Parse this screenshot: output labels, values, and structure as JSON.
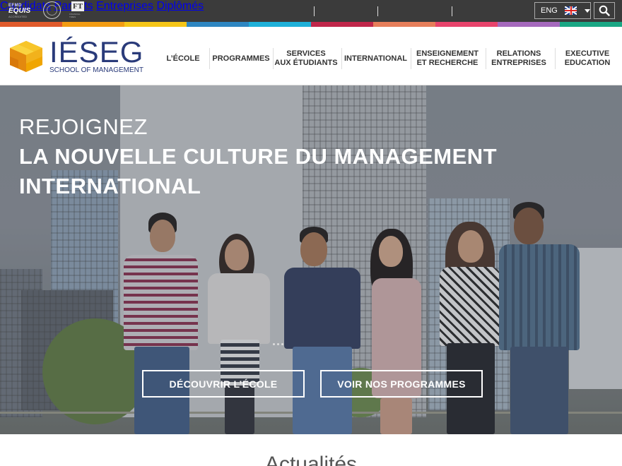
{
  "topbar": {
    "accreditations": {
      "equis_top": "EFMD",
      "equis_name": "EQUIS",
      "equis_sub": "ACCREDITED",
      "ft_name": "FT",
      "ft_sub": "FINANCIAL TIMES"
    },
    "links": [
      "Candidats",
      "Parents",
      "Entreprises",
      "Diplômés"
    ],
    "language": {
      "code": "ENG",
      "flag": "uk-flag-icon"
    },
    "search_icon": "search-icon"
  },
  "color_strip": [
    "#e05a2b",
    "#f39c12",
    "#f5c518",
    "#2e86c1",
    "#1eb0d8",
    "#c0264a",
    "#e67e5a",
    "#e8446c",
    "#a569bd",
    "#1aa784"
  ],
  "header": {
    "logo": {
      "word": "IÉSEG",
      "sub": "SCHOOL OF MANAGEMENT"
    },
    "nav": [
      {
        "line1": "L’ÉCOLE",
        "line2": ""
      },
      {
        "line1": "PROGRAMMES",
        "line2": ""
      },
      {
        "line1": "SERVICES",
        "line2": "AUX ÉTUDIANTS"
      },
      {
        "line1": "INTERNATIONAL",
        "line2": ""
      },
      {
        "line1": "ENSEIGNEMENT",
        "line2": "ET RECHERCHE"
      },
      {
        "line1": "RELATIONS",
        "line2": "ENTREPRISES"
      },
      {
        "line1": "EXECUTIVE",
        "line2": "EDUCATION"
      }
    ]
  },
  "hero": {
    "title_line1": "REJOIGNEZ",
    "title_line2": "LA NOUVELLE CULTURE DU MANAGEMENT INTERNATIONAL",
    "buttons": [
      "DÉCOUVRIR L’ÉCOLE",
      "VOIR NOS PROGRAMMES"
    ]
  },
  "news": {
    "title": "Actualités"
  }
}
